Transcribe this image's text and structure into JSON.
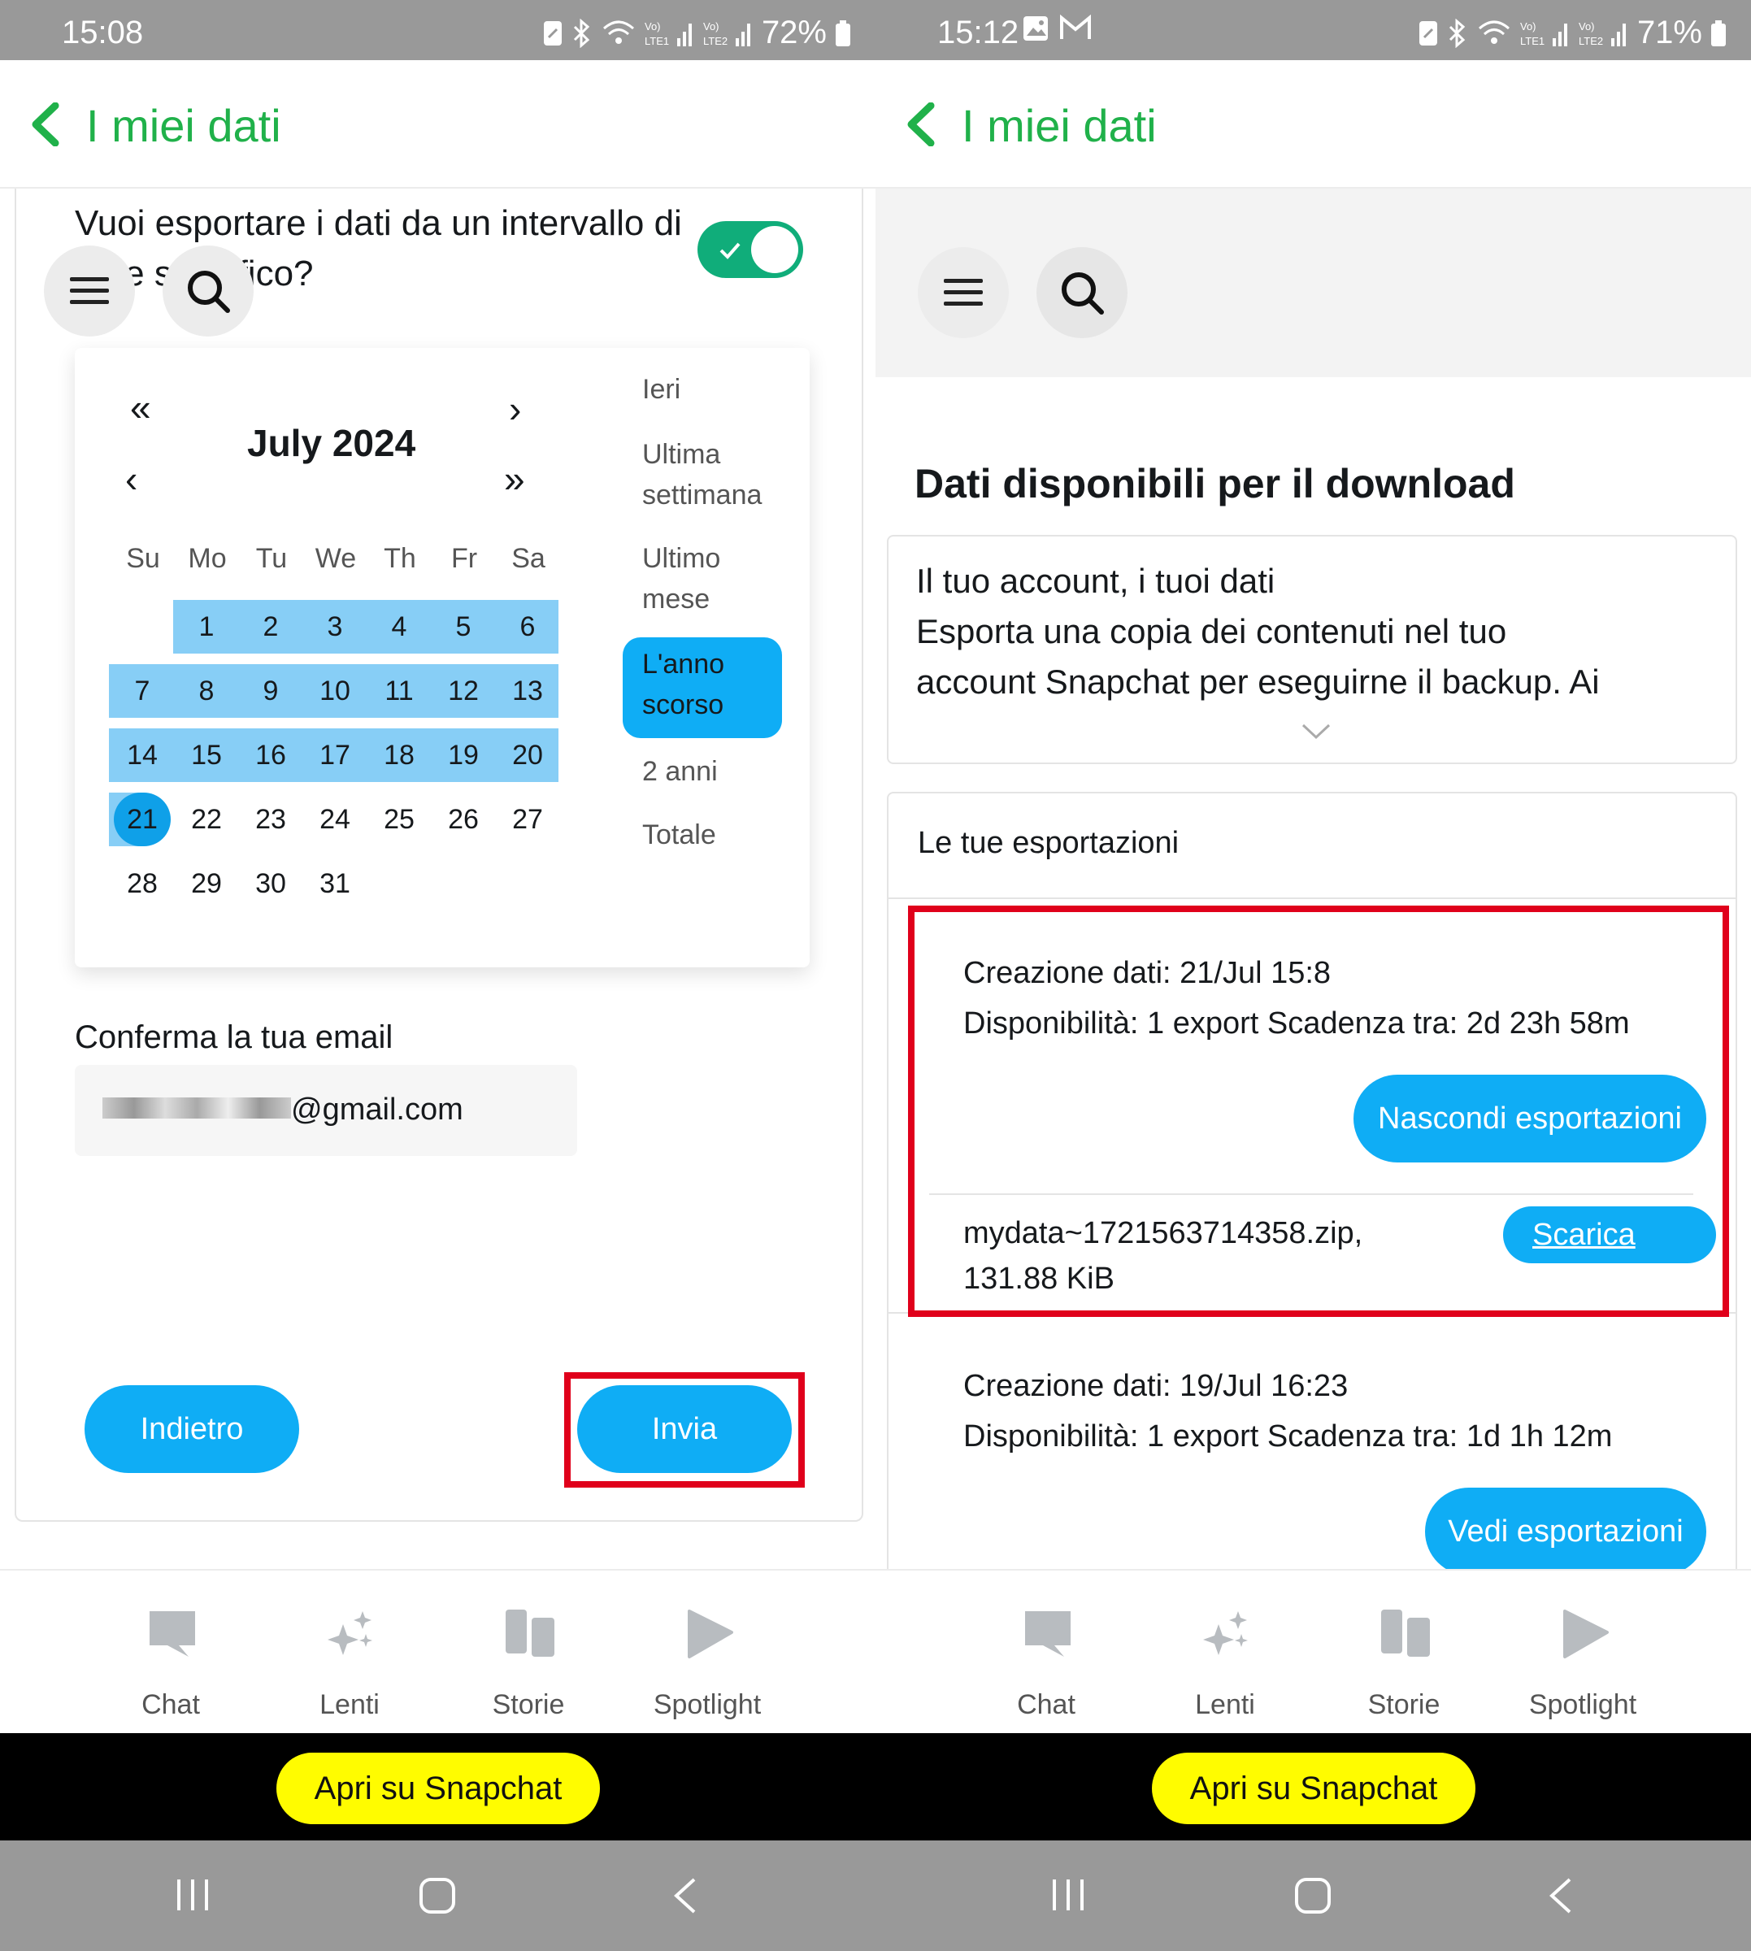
{
  "left": {
    "status": {
      "time": "15:08",
      "battery": "72%"
    },
    "header": {
      "title": "I miei dati"
    },
    "question": "Vuoi esportare i dati da un intervallo di date specifico?",
    "calendar": {
      "month": "July 2024",
      "weekdays": [
        "Su",
        "Mo",
        "Tu",
        "We",
        "Th",
        "Fr",
        "Sa"
      ],
      "weeks": [
        [
          "",
          "1",
          "2",
          "3",
          "4",
          "5",
          "6"
        ],
        [
          "7",
          "8",
          "9",
          "10",
          "11",
          "12",
          "13"
        ],
        [
          "14",
          "15",
          "16",
          "17",
          "18",
          "19",
          "20"
        ],
        [
          "21",
          "22",
          "23",
          "24",
          "25",
          "26",
          "27"
        ],
        [
          "28",
          "29",
          "30",
          "31",
          "",
          "",
          ""
        ]
      ],
      "selected_day": "21",
      "quick_ranges": [
        {
          "label": "Ieri"
        },
        {
          "label": "Ultima settimana"
        },
        {
          "label": "Ultimo mese"
        },
        {
          "label": "L'anno scorso",
          "selected": true
        },
        {
          "label": "2 anni"
        },
        {
          "label": "Totale"
        }
      ]
    },
    "email": {
      "label": "Conferma la tua email",
      "value": "@gmail.com"
    },
    "buttons": {
      "back": "Indietro",
      "send": "Invia"
    }
  },
  "right": {
    "status": {
      "time": "15:12",
      "battery": "71%"
    },
    "header": {
      "title": "I miei dati"
    },
    "section_title": "Dati disponibili per il download",
    "info": {
      "line1": "Il tuo account, i tuoi dati",
      "line2": "Esporta una copia dei contenuti nel tuo",
      "line3": "account Snapchat per eseguirne il backup. Ai"
    },
    "exports_title": "Le tue esportazioni",
    "exports": [
      {
        "created": "Creazione dati: 21/Jul 15:8",
        "availability": "Disponibilità: 1 export Scadenza tra: 2d 23h 58m",
        "toggle_label": "Nascondi esportazioni",
        "file_name": "mydata~1721563714358.zip,",
        "file_size": "131.88 KiB",
        "download_label": "Scarica"
      },
      {
        "created": "Creazione dati: 19/Jul 16:23",
        "availability": "Disponibilità: 1 export Scadenza tra: 1d 1h 12m",
        "toggle_label": "Vedi esportazioni"
      }
    ]
  },
  "tabs": [
    "Chat",
    "Lenti",
    "Storie",
    "Spotlight"
  ],
  "open_snapchat": "Apri su Snapchat",
  "colors": {
    "green": "#20b14a",
    "blue": "#0fadf5",
    "range": "#87cef6",
    "red": "#e0001b",
    "yellow": "#fffc00"
  }
}
